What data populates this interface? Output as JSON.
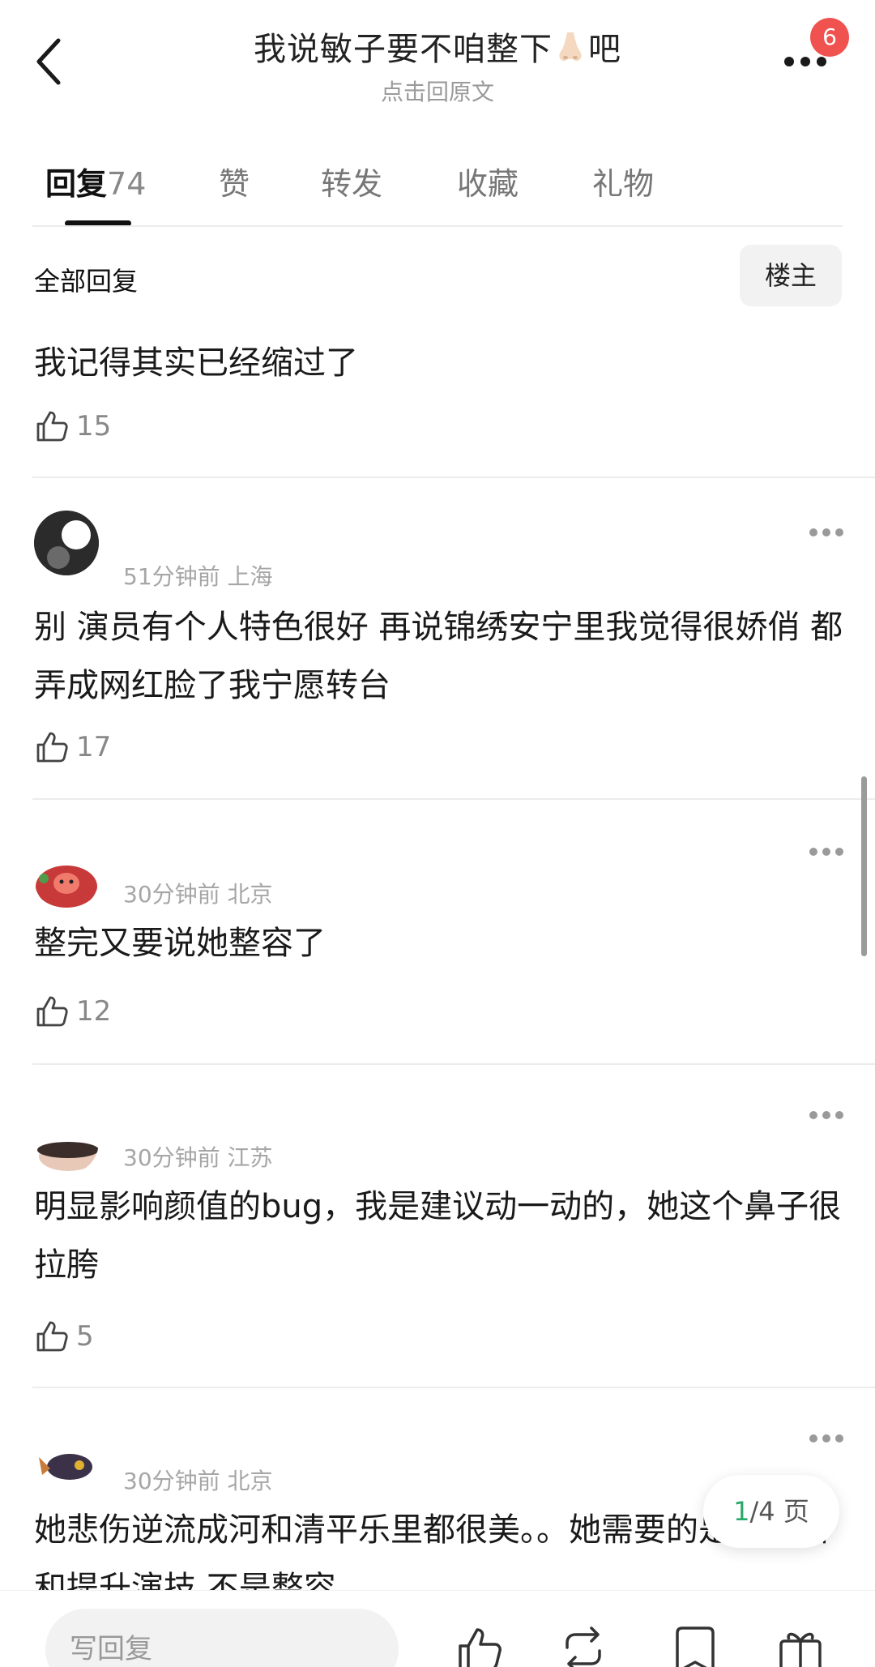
{
  "header": {
    "title_before": "我说敏子要不咱整下",
    "title_after": "吧",
    "subtitle": "点击回原文",
    "badge": "6"
  },
  "tabs": [
    {
      "label": "回复",
      "count": "74"
    },
    {
      "label": "赞"
    },
    {
      "label": "转发"
    },
    {
      "label": "收藏"
    },
    {
      "label": "礼物"
    }
  ],
  "filter": {
    "all_replies": "全部回复",
    "owner": "楼主"
  },
  "comments": [
    {
      "meta": "",
      "text": "我记得其实已经缩过了",
      "likes": "15"
    },
    {
      "meta": "51分钟前 上海",
      "text": "别 演员有个人特色很好 再说锦绣安宁里我觉得很娇俏   都弄成网红脸了我宁愿转台",
      "likes": "17"
    },
    {
      "meta": "30分钟前 北京",
      "text": "整完又要说她整容了",
      "likes": "12"
    },
    {
      "meta": "30分钟前 江苏",
      "text": "明显影响颜值的bug，我是建议动一动的，她这个鼻子很拉胯",
      "likes": "5"
    },
    {
      "meta": "30分钟前 北京",
      "text": "她悲伤逆流成河和清平乐里都很美。。她需要的是好作品和提升演技 不是整容",
      "likes": ""
    }
  ],
  "pager": {
    "current": "1",
    "rest": "/4 页"
  },
  "bottom": {
    "reply_placeholder": "写回复"
  },
  "colors": {
    "badge": "#f0524f",
    "pager_current": "#2aa86a"
  }
}
